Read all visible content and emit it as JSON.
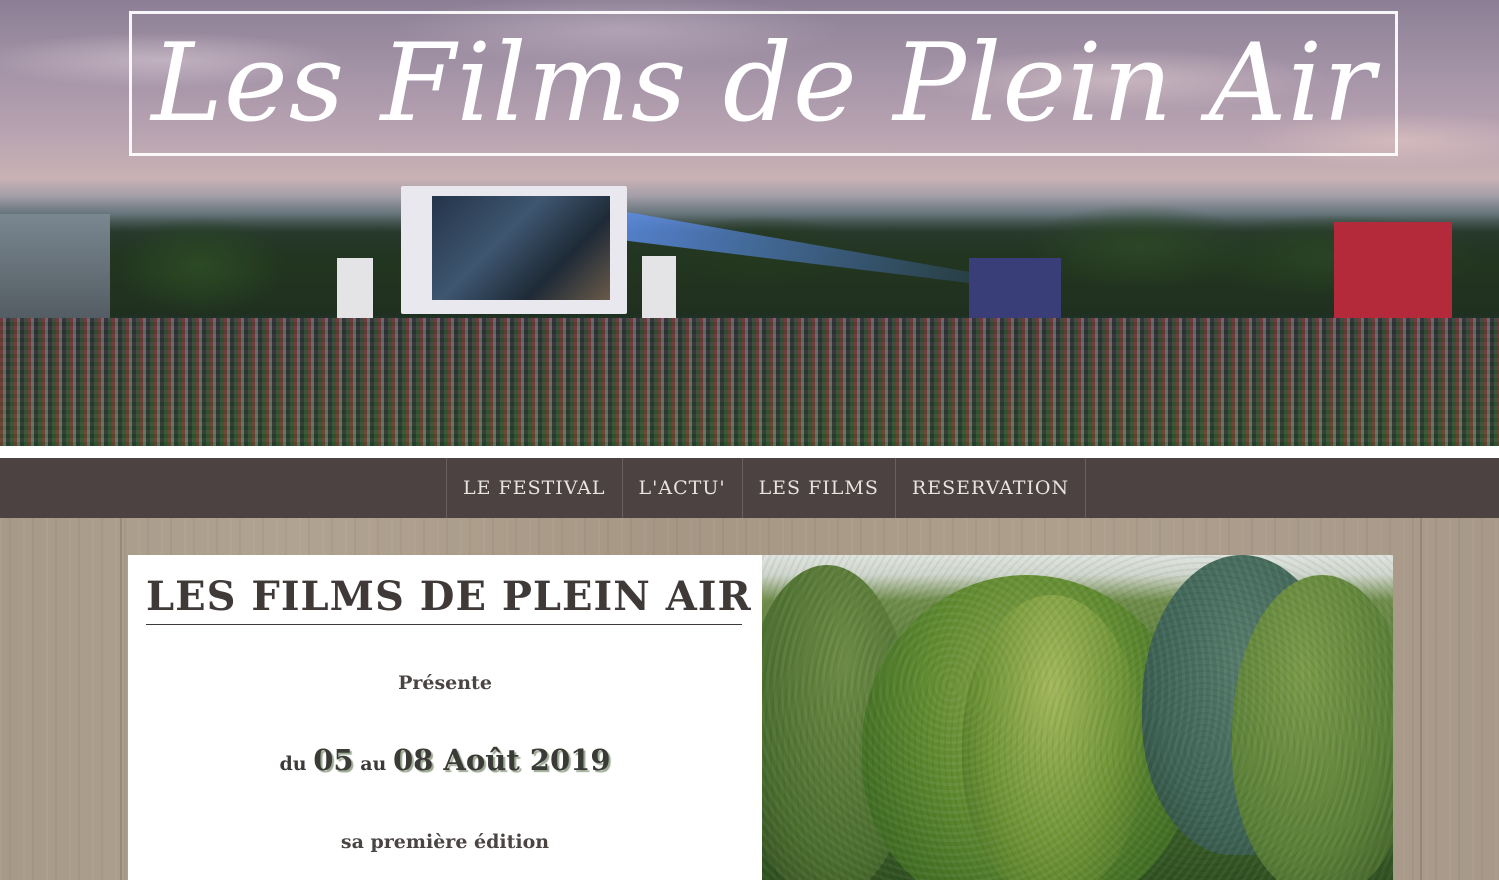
{
  "site": {
    "title": "Les Films de Plein Air"
  },
  "nav": {
    "items": [
      {
        "label": "LE FESTIVAL"
      },
      {
        "label": "L'ACTU'"
      },
      {
        "label": "LES FILMS"
      },
      {
        "label": "RESERVATION"
      }
    ]
  },
  "card": {
    "heading": "LES FILMS DE PLEIN AIR",
    "presente": "Présente",
    "dates": {
      "prefix": "du",
      "start_day": "05",
      "middle": "au",
      "end": "08 Août 2019"
    },
    "edition": "sa première édition"
  },
  "colors": {
    "nav_background": "#4b4241",
    "nav_text": "#e9e3e0",
    "heading_text": "#3f3a38",
    "wood_background": "#a89a88"
  },
  "images": {
    "hero": "outdoor-cinema-crowd-photo",
    "side_photo": "park-trees-photo"
  }
}
